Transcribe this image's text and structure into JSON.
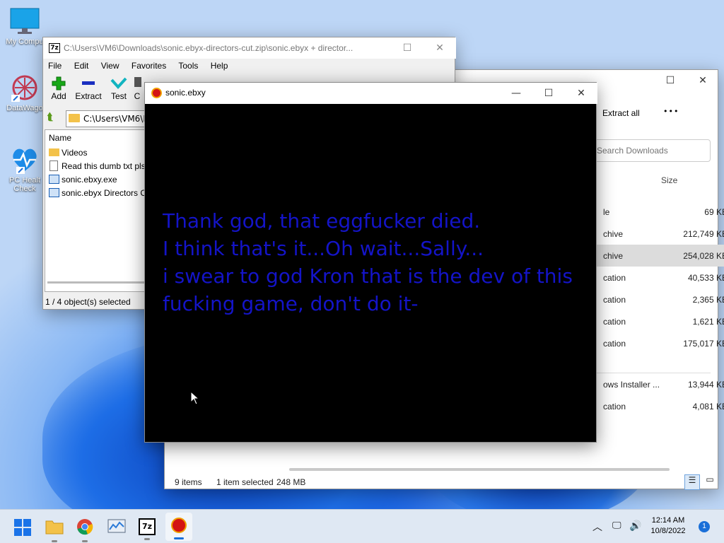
{
  "desktop": {
    "icons": [
      {
        "label": "My Compu"
      },
      {
        "label": "DataWago"
      },
      {
        "label": "PC Healt"
      },
      {
        "label": "Check"
      }
    ]
  },
  "zip": {
    "title": "C:\\Users\\VM6\\Downloads\\sonic.ebyx-directors-cut.zip\\sonic.ebyx + director...",
    "logo": "7z",
    "menu": [
      "File",
      "Edit",
      "View",
      "Favorites",
      "Tools",
      "Help"
    ],
    "toolbar": {
      "add": "Add",
      "extract": "Extract",
      "test": "Test",
      "copy": "C"
    },
    "path": "C:\\Users\\VM6\\D",
    "column": "Name",
    "files": [
      "Videos",
      "Read this dumb txt pls",
      "sonic.ebxy.exe",
      "sonic.ebyx Directors Cu"
    ],
    "status": "1 / 4 object(s) selected"
  },
  "explorer": {
    "extract_all": "Extract all",
    "more": "•••",
    "search_placeholder": "Search Downloads",
    "size_header": "Size",
    "rows": [
      {
        "type": "le",
        "size": "69 KB"
      },
      {
        "type": "chive",
        "size": "212,749 KB"
      },
      {
        "type": "chive",
        "size": "254,028 KB",
        "selected": true
      },
      {
        "type": "cation",
        "size": "40,533 KB"
      },
      {
        "type": "cation",
        "size": "2,365 KB"
      },
      {
        "type": "cation",
        "size": "1,621 KB"
      },
      {
        "type": "cation",
        "size": "175,017 KB"
      },
      {
        "type": "ows Installer ...",
        "size": "13,944 KB"
      },
      {
        "type": "cation",
        "size": "4,081 KB"
      }
    ],
    "status": {
      "items": "9 items",
      "selected": "1 item selected",
      "size": "248 MB"
    }
  },
  "game": {
    "title": "sonic.ebxy",
    "lines": [
      "Thank god, that eggfucker died.",
      "I think that's it...Oh wait...Sally...",
      "i swear to god Kron that is the dev of this",
      "fucking game, don't do it-"
    ],
    "text_color": "#1414c8"
  },
  "taskbar": {
    "time": "12:14 AM",
    "date": "10/8/2022",
    "notification_count": "1",
    "zip_label": "7z"
  }
}
